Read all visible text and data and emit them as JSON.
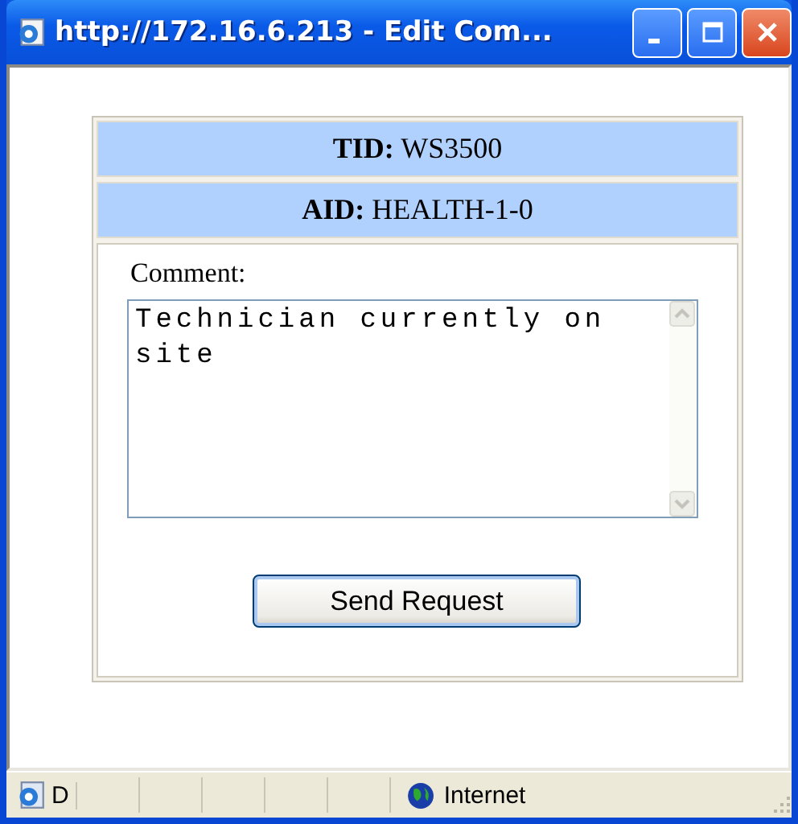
{
  "window": {
    "title": "http://172.16.6.213 - Edit Com..."
  },
  "header_rows": [
    {
      "label": "TID:",
      "value": "WS3500"
    },
    {
      "label": "AID:",
      "value": "HEALTH-1-0"
    }
  ],
  "comment": {
    "label": "Comment:",
    "value": "Technician currently on site"
  },
  "button": "Send Request",
  "status_bar": {
    "text": "D",
    "zone": "Internet"
  }
}
